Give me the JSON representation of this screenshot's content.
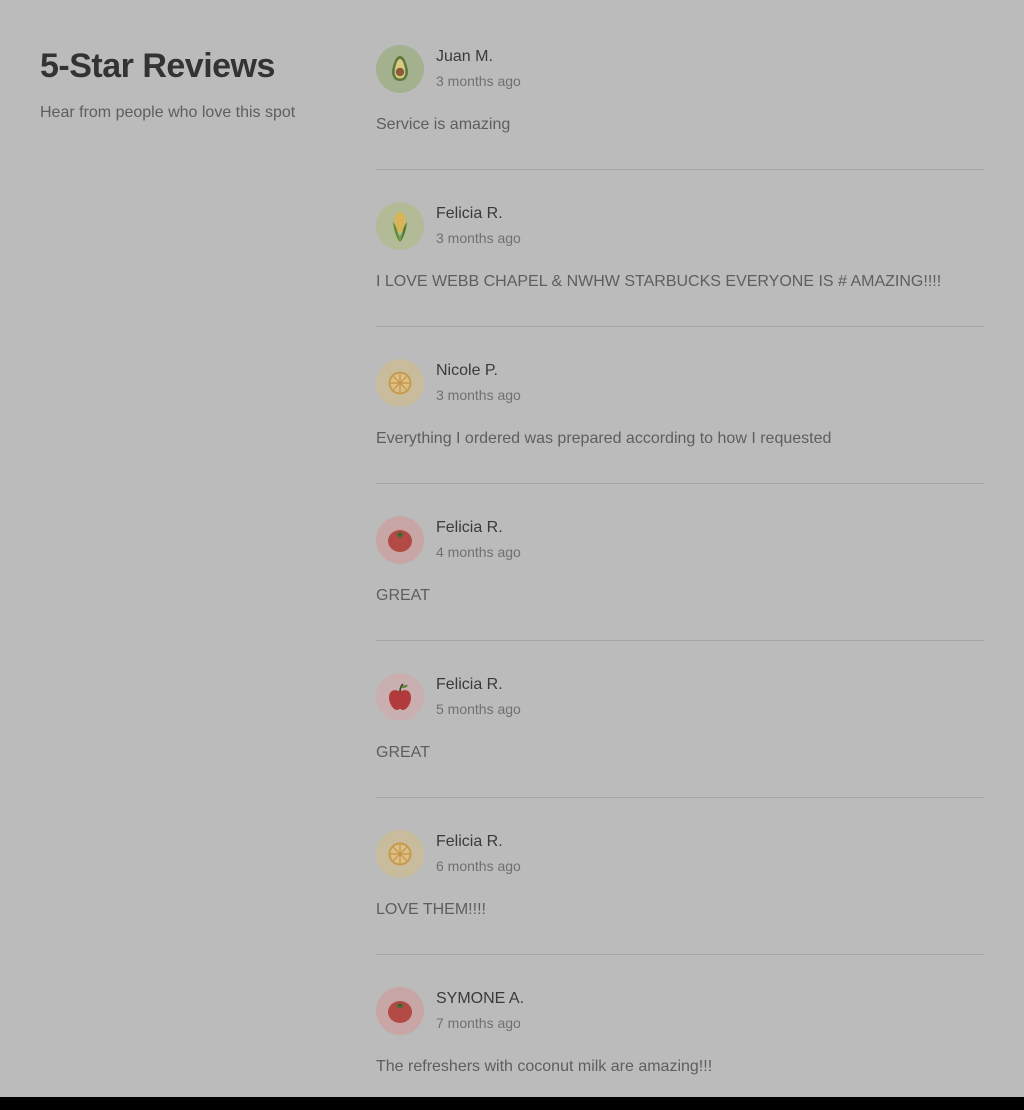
{
  "header": {
    "title": "5-Star Reviews",
    "subtitle": "Hear from people who love this spot"
  },
  "reviews": [
    {
      "name": "Juan M.",
      "time": "3 months ago",
      "text": "Service is amazing",
      "avatar_icon": "avocado-icon",
      "avatar_bg": "#a3b18e"
    },
    {
      "name": "Felicia R.",
      "time": "3 months ago",
      "text": "I LOVE WEBB CHAPEL & NWHW STARBUCKS EVERYONE IS # AMAZING!!!!",
      "avatar_icon": "corn-icon",
      "avatar_bg": "#b2bb96"
    },
    {
      "name": "Nicole P.",
      "time": "3 months ago",
      "text": "Everything I ordered was prepared according to how I requested",
      "avatar_icon": "orange-slice-icon",
      "avatar_bg": "#c9bc9c"
    },
    {
      "name": "Felicia R.",
      "time": "4 months ago",
      "text": "GREAT",
      "avatar_icon": "tomato-icon",
      "avatar_bg": "#c9a6a6"
    },
    {
      "name": "Felicia R.",
      "time": "5 months ago",
      "text": "GREAT",
      "avatar_icon": "apple-icon",
      "avatar_bg": "#c9afaf"
    },
    {
      "name": "Felicia R.",
      "time": "6 months ago",
      "text": "LOVE THEM!!!!",
      "avatar_icon": "orange-slice-icon",
      "avatar_bg": "#c9bc9c"
    },
    {
      "name": "SYMONE A.",
      "time": "7 months ago",
      "text": "The refreshers with coconut milk are amazing!!!",
      "avatar_icon": "tomato-icon",
      "avatar_bg": "#c9a6a6"
    }
  ]
}
